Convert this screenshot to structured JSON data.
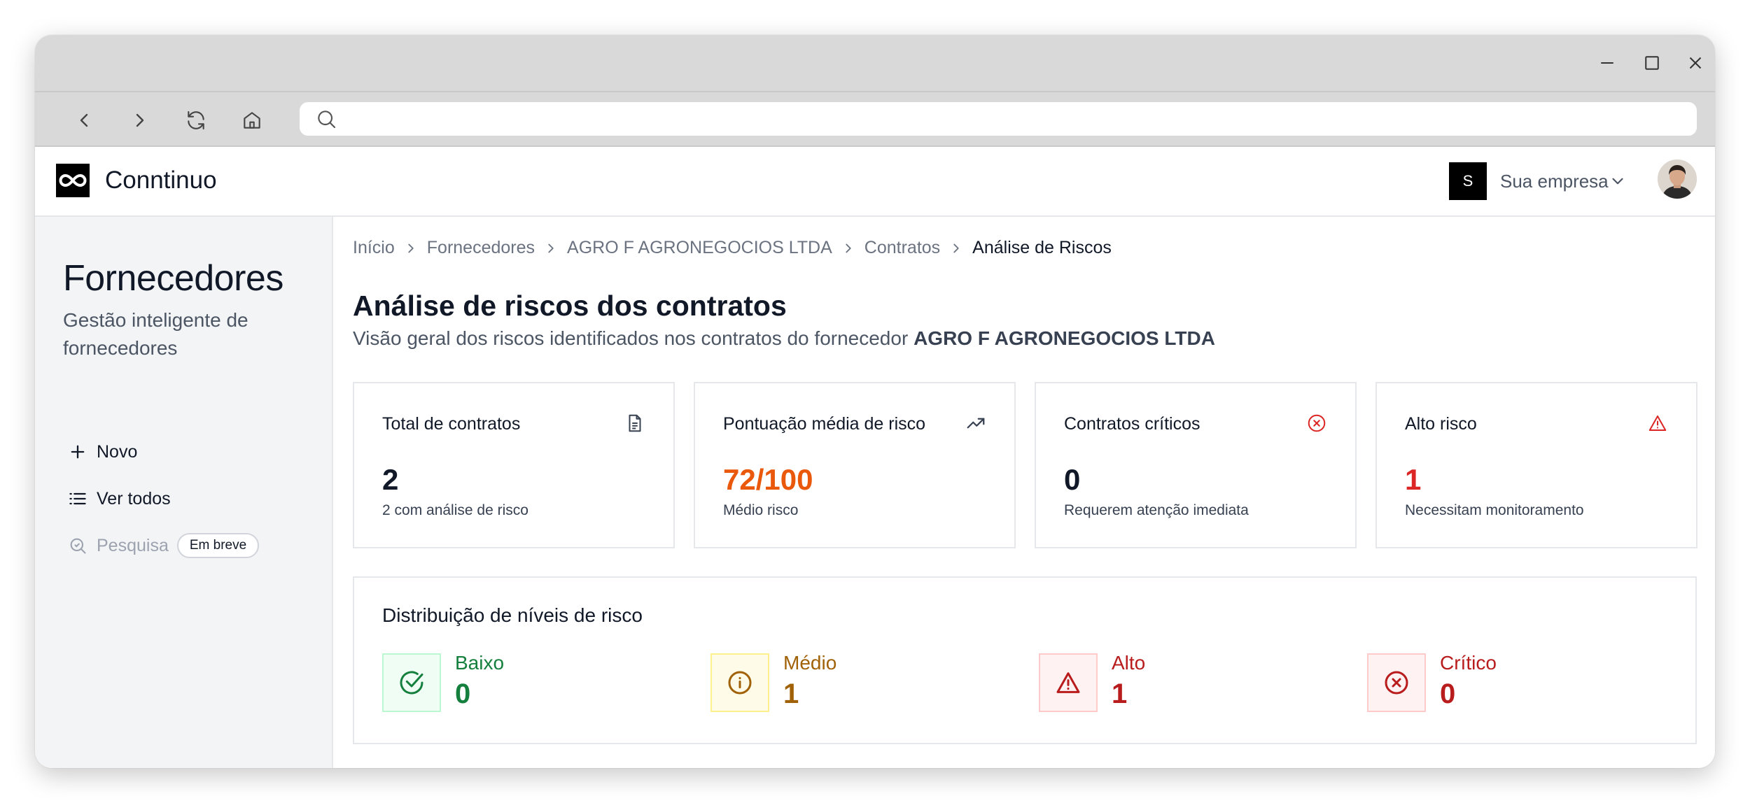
{
  "browser": {
    "url": ""
  },
  "app": {
    "brand_name": "Conntinuo",
    "company_initial": "S",
    "company_name": "Sua empresa"
  },
  "sidebar": {
    "title": "Fornecedores",
    "subtitle": "Gestão inteligente de fornecedores",
    "items": [
      {
        "label": "Novo",
        "icon": "plus-icon"
      },
      {
        "label": "Ver todos",
        "icon": "list-icon"
      },
      {
        "label": "Pesquisa",
        "icon": "search-sparkle-icon",
        "badge": "Em breve"
      }
    ]
  },
  "breadcrumb": [
    "Início",
    "Fornecedores",
    "AGRO F AGRONEGOCIOS LTDA",
    "Contratos",
    "Análise de Riscos"
  ],
  "page": {
    "title": "Análise de riscos dos contratos",
    "subtitle_prefix": "Visão geral dos riscos identificados nos contratos do fornecedor",
    "subtitle_supplier": "AGRO F AGRONEGOCIOS LTDA"
  },
  "cards": [
    {
      "title": "Total de contratos",
      "value": "2",
      "note": "2 com análise de risco",
      "icon": "document-icon"
    },
    {
      "title": "Pontuação média de risco",
      "value": "72/100",
      "note": "Médio risco",
      "icon": "trending-up-icon"
    },
    {
      "title": "Contratos críticos",
      "value": "0",
      "note": "Requerem atenção imediata",
      "icon": "x-circle-icon"
    },
    {
      "title": "Alto risco",
      "value": "1",
      "note": "Necessitam monitoramento",
      "icon": "alert-triangle-icon"
    }
  ],
  "distribution": {
    "title": "Distribuição de níveis de risco",
    "levels": [
      {
        "label": "Baixo",
        "count": "0",
        "icon": "check-circle-icon"
      },
      {
        "label": "Médio",
        "count": "1",
        "icon": "info-circle-icon"
      },
      {
        "label": "Alto",
        "count": "1",
        "icon": "alert-triangle-icon"
      },
      {
        "label": "Crítico",
        "count": "0",
        "icon": "x-circle-icon"
      }
    ]
  },
  "colors": {
    "orange_value": "#ea580c",
    "red_value": "#dc2626",
    "baixo_text": "#15803d",
    "baixo_bg": "#f0fdf4",
    "medio_text": "#a16207",
    "medio_bg": "#fefce8",
    "alto_text": "#b91c1c",
    "alto_bg": "#fef2f2",
    "critico_text": "#b91c1c",
    "critico_bg": "#fef2f2"
  }
}
